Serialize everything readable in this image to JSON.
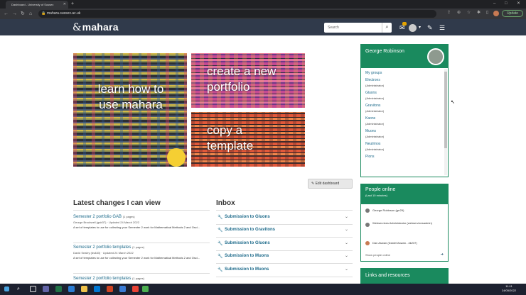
{
  "browser": {
    "tab_title": "Dashboard - University of Sussex",
    "url": "mahara.sussex.ac.uk",
    "update_label": "Update"
  },
  "header": {
    "logo_text": "mahara",
    "search_placeholder": "Search"
  },
  "tiles": {
    "learn": "learn how to use mahara",
    "create": "create a new portfolio",
    "copy": "copy a template"
  },
  "edit_dashboard": "Edit dashboard",
  "latest_changes": {
    "title": "Latest changes I can view",
    "items": [
      {
        "title": "Semester 2 portfolio GAB",
        "pages": "(1 pages)",
        "meta": "George Brockwell (gab37) · Updated 24 March 2022",
        "desc": "A set of templates to use for collecting your Semester 2 work for Mathematical Methods 2 and Osci..."
      },
      {
        "title": "Semester 2 portfolio templates",
        "pages": "(1 pages)",
        "meta": "David Sealey (ds483) · Updated 24 March 2022",
        "desc": "A set of templates to use for collecting your Semester 2 work for Mathematical Methods 2 and Osci..."
      },
      {
        "title": "Semester 2 portfolio templates",
        "pages": "(1 pages)",
        "meta": "",
        "desc": ""
      }
    ]
  },
  "inbox": {
    "title": "Inbox",
    "items": [
      "Submission to Gluons",
      "Submission to Gravitons",
      "Submission to Gluons",
      "Submission to Muons",
      "Submission to Muons"
    ]
  },
  "profile": {
    "name": "George Robinson",
    "groups_heading": "My groups",
    "groups": [
      {
        "name": "Electrons",
        "role": "(Administrator)"
      },
      {
        "name": "Gluons",
        "role": "(Administrator)"
      },
      {
        "name": "Gravitons",
        "role": "(Administrator)"
      },
      {
        "name": "Kaons",
        "role": "(Administrator)"
      },
      {
        "name": "Muons",
        "role": "(Administrator)"
      },
      {
        "name": "Neutrinos",
        "role": "(Administrator)"
      },
      {
        "name": "Pions",
        "role": "(Administrator)"
      }
    ]
  },
  "people_online": {
    "title": "People online",
    "subtitle": "(Last 10 minutes)",
    "people": [
      "George Robinson (grr29)",
      "Webservices Administrator (webservicesadmin)",
      "Dan Aswan (Daniel Aswan - dk237)"
    ],
    "show_link": "Show people online"
  },
  "links_resources": {
    "title": "Links and resources"
  },
  "clock": {
    "time": "11:11",
    "date": "24/05/2022"
  }
}
